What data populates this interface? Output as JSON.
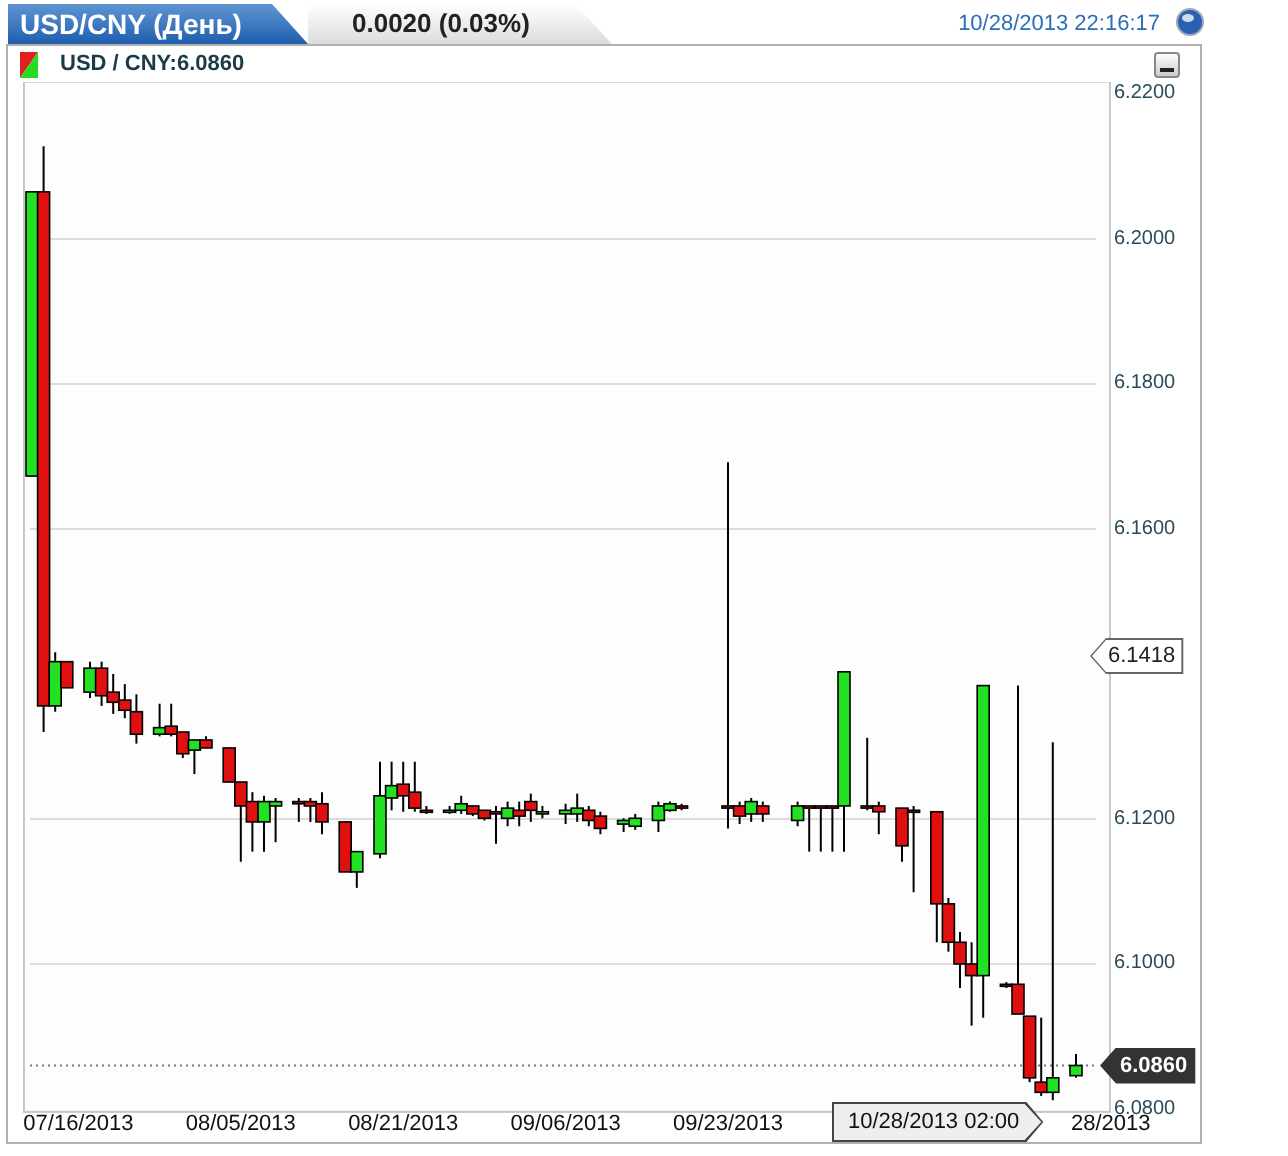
{
  "header": {
    "tab_title": "USD/CNY (День)",
    "change": "0.0020 (0.03%)",
    "timestamp": "10/28/2013 22:16:17"
  },
  "chart": {
    "symbol_label": "USD / CNY:6.0860",
    "high_marker": "6.1418",
    "crosshair_date": "10/28/2013 02:00",
    "chart_data": {
      "type": "candlestick",
      "ylim": [
        6.0796,
        6.2217
      ],
      "grid": true,
      "ref_lines": [
        {
          "value": 6.086,
          "axis": "y",
          "label": "6.0860"
        }
      ],
      "yticks": [
        {
          "value": 6.22,
          "label": "6.2200"
        },
        {
          "value": 6.2,
          "label": "6.2000"
        },
        {
          "value": 6.18,
          "label": "6.1800"
        },
        {
          "value": 6.16,
          "label": "6.1600"
        },
        {
          "value": 6.12,
          "label": "6.1200"
        },
        {
          "value": 6.1,
          "label": "6.1000"
        },
        {
          "value": 6.08,
          "label": "6.0800"
        }
      ],
      "categories": [
        null,
        null,
        null,
        null,
        "07/16/2013",
        null,
        null,
        null,
        null,
        null,
        null,
        null,
        null,
        null,
        null,
        null,
        null,
        null,
        "08/05/2013",
        null,
        null,
        null,
        null,
        null,
        null,
        null,
        null,
        null,
        null,
        null,
        null,
        null,
        "08/21/2013",
        null,
        null,
        null,
        null,
        null,
        null,
        null,
        null,
        null,
        null,
        null,
        null,
        null,
        "09/06/2013",
        null,
        null,
        null,
        null,
        null,
        null,
        null,
        null,
        null,
        null,
        null,
        null,
        null,
        "09/23/2013",
        null,
        null,
        null,
        null,
        null,
        null,
        null,
        null,
        null,
        null,
        null,
        null,
        null,
        null,
        null,
        null,
        null,
        null,
        null,
        null,
        null,
        null,
        null,
        null,
        null,
        null,
        null,
        null,
        null,
        null,
        null,
        null,
        "28/2013"
      ],
      "ohlc": [
        [
          6.1673,
          6.2065,
          6.1673,
          6.2065
        ],
        [
          6.2065,
          6.2128,
          6.132,
          6.1356
        ],
        [
          6.1356,
          6.143,
          6.1348,
          6.1417
        ],
        [
          6.1417,
          6.1417,
          6.1381,
          6.1381
        ],
        null,
        [
          6.1375,
          6.1417,
          6.1367,
          6.1408
        ],
        [
          6.1408,
          6.1417,
          6.1356,
          6.137
        ],
        [
          6.1375,
          6.14,
          6.1345,
          6.1361
        ],
        [
          6.1364,
          6.1386,
          6.1339,
          6.135
        ],
        [
          6.1348,
          6.1372,
          6.1304,
          6.1317
        ],
        null,
        [
          6.1317,
          6.1359,
          6.1314,
          6.1326
        ],
        [
          6.1328,
          6.1359,
          6.1314,
          6.1317
        ],
        [
          6.132,
          6.132,
          6.1284,
          6.129
        ],
        [
          6.1295,
          6.1309,
          6.1262,
          6.1309
        ],
        [
          6.1309,
          6.1314,
          6.1298,
          6.1298
        ],
        null,
        [
          6.1298,
          6.1298,
          6.1251,
          6.1251
        ],
        [
          6.1251,
          6.1251,
          6.1141,
          6.1218
        ],
        [
          6.1224,
          6.1237,
          6.1155,
          6.1196
        ],
        [
          6.1196,
          6.1232,
          6.1155,
          6.1224
        ],
        [
          6.1218,
          6.1229,
          6.1168,
          6.1224
        ],
        null,
        [
          6.1224,
          6.1229,
          6.1196,
          6.1221
        ],
        [
          6.1224,
          6.1229,
          6.1196,
          6.1218
        ],
        [
          6.1221,
          6.1237,
          6.1179,
          6.1196
        ],
        null,
        [
          6.1196,
          6.1196,
          6.1127,
          6.1127
        ],
        [
          6.1127,
          6.1155,
          6.1105,
          6.1155
        ],
        null,
        [
          6.1152,
          6.1279,
          6.1146,
          6.1232
        ],
        [
          6.1229,
          6.1279,
          6.1212,
          6.1246
        ],
        [
          6.1248,
          6.1279,
          6.121,
          6.1232
        ],
        [
          6.1237,
          6.1279,
          6.121,
          6.1215
        ],
        [
          6.1212,
          6.1218,
          6.1207,
          6.121
        ],
        null,
        [
          6.121,
          6.1218,
          6.1207,
          6.1212
        ],
        [
          6.1212,
          6.1232,
          6.1207,
          6.1221
        ],
        [
          6.1218,
          6.1218,
          6.1204,
          6.1207
        ],
        [
          6.1212,
          6.1212,
          6.1198,
          6.1201
        ],
        [
          6.121,
          6.1218,
          6.1166,
          6.1207
        ],
        [
          6.1201,
          6.1224,
          6.119,
          6.1215
        ],
        [
          6.1212,
          6.1224,
          6.119,
          6.1204
        ],
        [
          6.1224,
          6.1235,
          6.1196,
          6.1212
        ],
        [
          6.1207,
          6.1218,
          6.1201,
          6.121
        ],
        null,
        [
          6.1207,
          6.1221,
          6.1193,
          6.1212
        ],
        [
          6.1207,
          6.1235,
          6.1196,
          6.1215
        ],
        [
          6.1212,
          6.1218,
          6.119,
          6.1198
        ],
        [
          6.1204,
          6.121,
          6.1179,
          6.1187
        ],
        null,
        [
          6.1193,
          6.1201,
          6.1182,
          6.1198
        ],
        [
          6.119,
          6.1207,
          6.1185,
          6.1201
        ],
        null,
        [
          6.1198,
          6.1224,
          6.1182,
          6.1218
        ],
        [
          6.1212,
          6.1224,
          6.121,
          6.1221
        ],
        [
          6.1218,
          6.1221,
          6.1212,
          6.1215
        ],
        null,
        null,
        null,
        [
          6.1218,
          6.1692,
          6.1187,
          6.1215
        ],
        [
          6.1218,
          6.1224,
          6.1193,
          6.1204
        ],
        [
          6.1207,
          6.1229,
          6.1196,
          6.1224
        ],
        [
          6.1218,
          6.1224,
          6.1196,
          6.1207
        ],
        null,
        null,
        [
          6.1198,
          6.1224,
          6.119,
          6.1218
        ],
        [
          6.1218,
          6.1218,
          6.1155,
          6.1215
        ],
        [
          6.1218,
          6.1218,
          6.1155,
          6.1215
        ],
        [
          6.1218,
          6.1218,
          6.1155,
          6.1215
        ],
        [
          6.1218,
          6.1403,
          6.1155,
          6.1403
        ],
        null,
        [
          6.1218,
          6.1312,
          6.1212,
          6.1215
        ],
        [
          6.1218,
          6.1224,
          6.1179,
          6.121
        ],
        null,
        [
          6.1215,
          6.1215,
          6.1141,
          6.1163
        ],
        [
          6.1212,
          6.1218,
          6.1099,
          6.121
        ],
        null,
        [
          6.121,
          6.121,
          6.103,
          6.1083
        ],
        [
          6.1083,
          6.1091,
          6.1017,
          6.103
        ],
        [
          6.103,
          6.1044,
          6.0967,
          6.1
        ],
        [
          6.1,
          6.103,
          6.0915,
          6.0984
        ],
        [
          6.0984,
          6.1384,
          6.0926,
          6.1384
        ],
        null,
        [
          6.0972,
          6.0975,
          6.0967,
          6.097
        ],
        [
          6.0972,
          6.1384,
          6.0931,
          6.0931
        ],
        [
          6.0928,
          6.0928,
          6.0837,
          6.0843
        ],
        [
          6.0837,
          6.0926,
          6.0818,
          6.0823
        ],
        [
          6.0823,
          6.1306,
          6.0812,
          6.0843
        ],
        null,
        [
          6.0846,
          6.0876,
          6.0843,
          6.086
        ],
        null,
        null,
        null
      ]
    }
  }
}
